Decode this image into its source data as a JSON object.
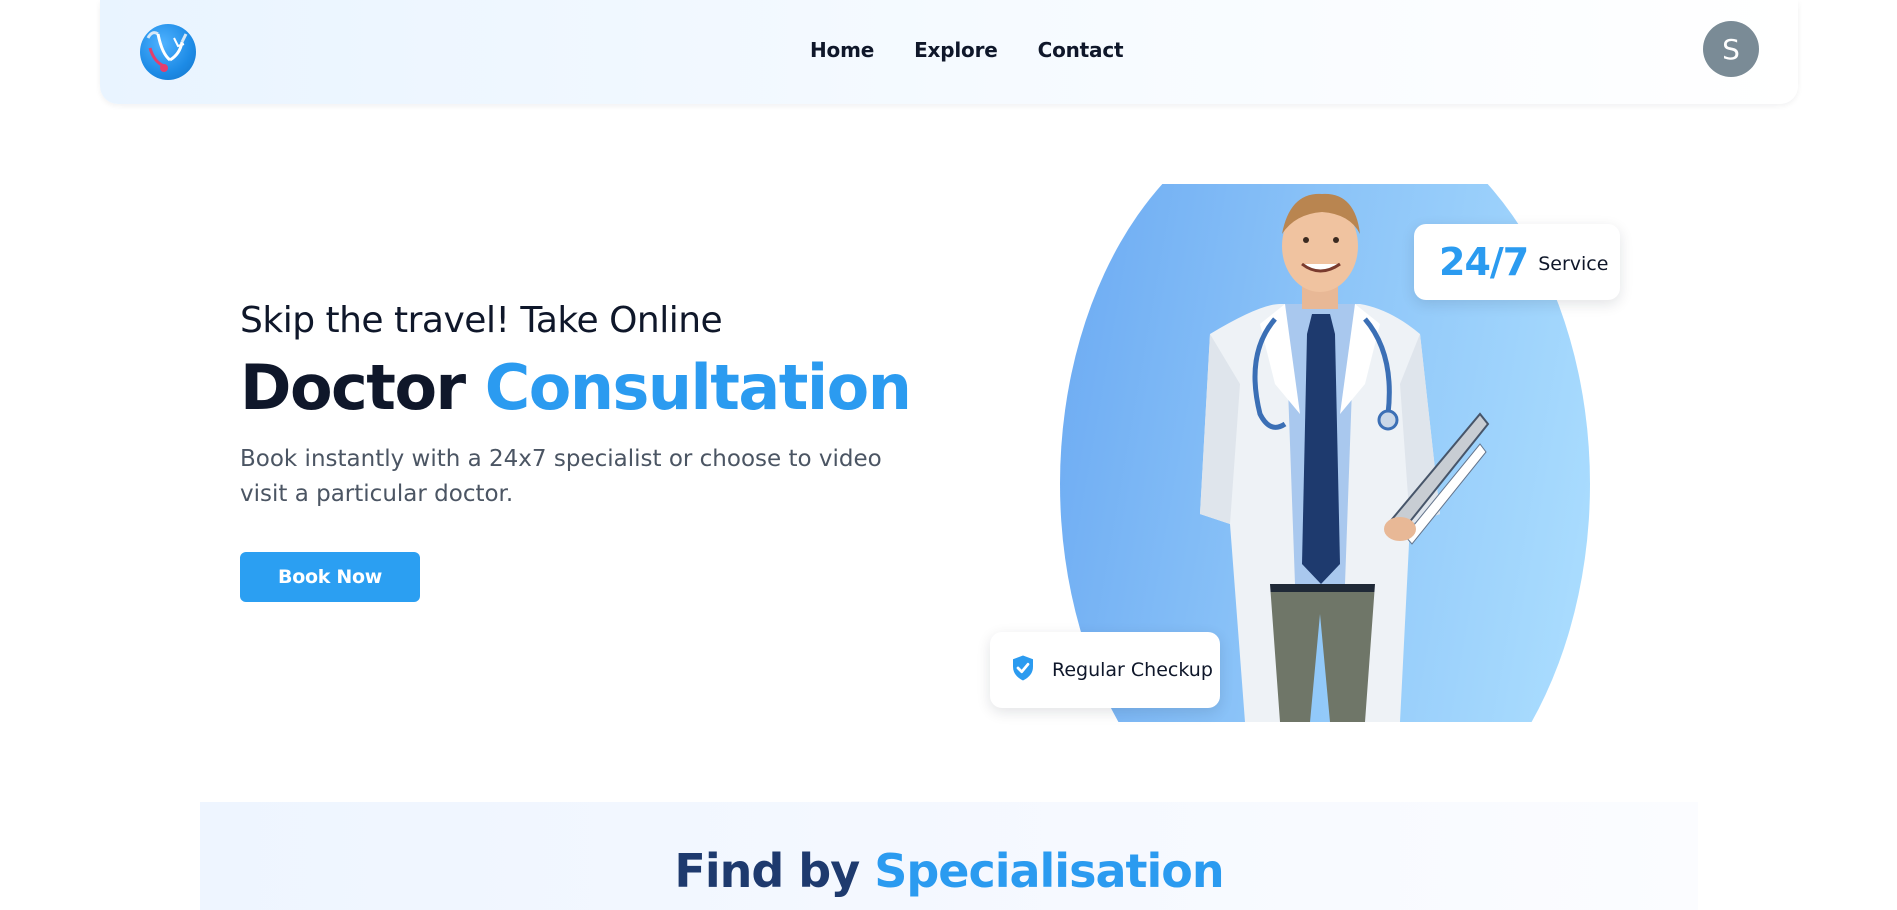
{
  "navbar": {
    "logo_icon": "stethoscope-globe-logo",
    "links": [
      "Home",
      "Explore",
      "Contact"
    ],
    "avatar_initial": "S"
  },
  "hero": {
    "pre_title": "Skip the travel! Take Online",
    "title_dark": "Doctor",
    "title_accent": "Consultation",
    "description": "Book instantly with a 24x7 specialist or choose to video visit a particular doctor.",
    "cta_label": "Book Now"
  },
  "badges": {
    "service_big": "24/7",
    "service_small": "Service",
    "checkup_icon": "shield-check-icon",
    "checkup_label": "Regular Checkup"
  },
  "specialisation": {
    "title_dark": "Find by",
    "title_accent": "Specialisation"
  },
  "colors": {
    "accent": "#2b9bf0",
    "button": "#2b9ff2",
    "text_dark": "#0f172a",
    "avatar": "#7a8b96"
  }
}
